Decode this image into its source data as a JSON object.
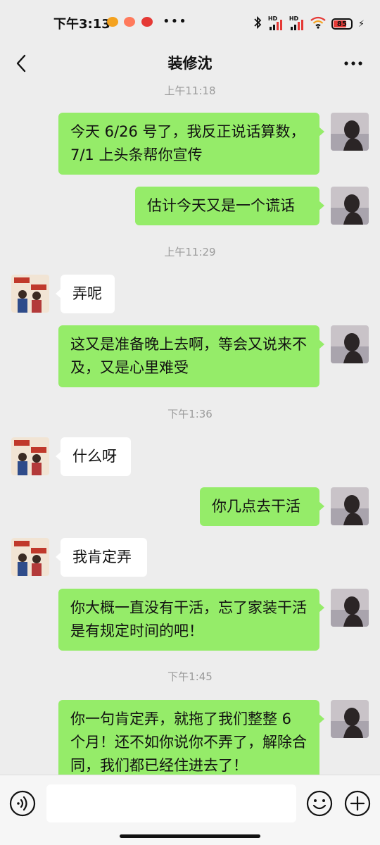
{
  "status_bar": {
    "time": "下午3:13",
    "overflow": "•••",
    "hd_label": "HD",
    "battery": "85"
  },
  "nav": {
    "title": "装修沈"
  },
  "messages": [
    {
      "type": "timestamp",
      "text": "上午11:18"
    },
    {
      "type": "sent",
      "text": "今天 6/26 号了，我反正说话算数，7/1 上头条帮你宣传"
    },
    {
      "type": "sent",
      "text": "估计今天又是一个谎话"
    },
    {
      "type": "timestamp",
      "text": "上午11:29"
    },
    {
      "type": "received",
      "text": "弄呢"
    },
    {
      "type": "sent",
      "text": "这又是准备晚上去啊，等会又说来不及，又是心里难受"
    },
    {
      "type": "timestamp",
      "text": "下午1:36"
    },
    {
      "type": "received",
      "text": "什么呀"
    },
    {
      "type": "sent",
      "text": "你几点去干活"
    },
    {
      "type": "received",
      "text": "我肯定弄"
    },
    {
      "type": "sent",
      "text": "你大概一直没有干活，忘了家装干活是有规定时间的吧！"
    },
    {
      "type": "timestamp",
      "text": "下午1:45"
    },
    {
      "type": "sent",
      "text": "你一句肯定弄，就拖了我们整整 6 个月！还不如你说你不弄了，解除合同，我们都已经住进去了！"
    }
  ],
  "colors": {
    "sent_bubble": "#95ec69",
    "received_bubble": "#ffffff",
    "background": "#ededed"
  }
}
